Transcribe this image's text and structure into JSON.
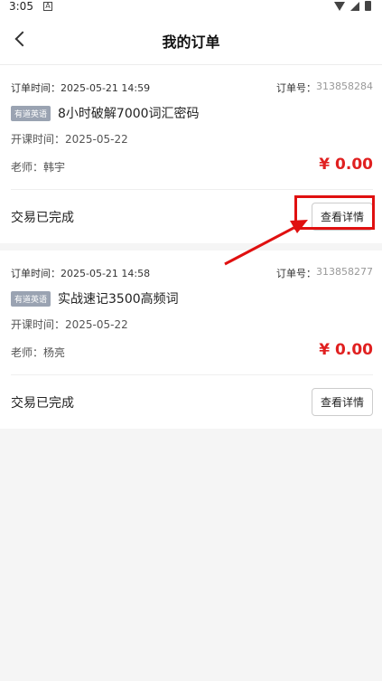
{
  "status_bar": {
    "time": "3:05",
    "app_letter": "A"
  },
  "header": {
    "title": "我的订单"
  },
  "orders": [
    {
      "order_time_label": "订单时间：",
      "order_time": "2025-05-21 14:59",
      "order_no_label": "订单号：",
      "order_no": "313858284",
      "tag": "有道英语",
      "course_name": "8小时破解7000词汇密码",
      "start_label": "开课时间：",
      "start_date": "2025-05-22",
      "teacher_label": "老师：",
      "teacher": "韩宇",
      "price": "¥ 0.00",
      "status": "交易已完成",
      "detail_button": "查看详情"
    },
    {
      "order_time_label": "订单时间：",
      "order_time": "2025-05-21 14:58",
      "order_no_label": "订单号：",
      "order_no": "313858277",
      "tag": "有道英语",
      "course_name": "实战速记3500高频词",
      "start_label": "开课时间：",
      "start_date": "2025-05-22",
      "teacher_label": "老师：",
      "teacher": "杨亮",
      "price": "¥ 0.00",
      "status": "交易已完成",
      "detail_button": "查看详情"
    }
  ],
  "colors": {
    "price": "#e02020",
    "highlight": "#e01010",
    "tag_bg": "#9aa3b2"
  }
}
